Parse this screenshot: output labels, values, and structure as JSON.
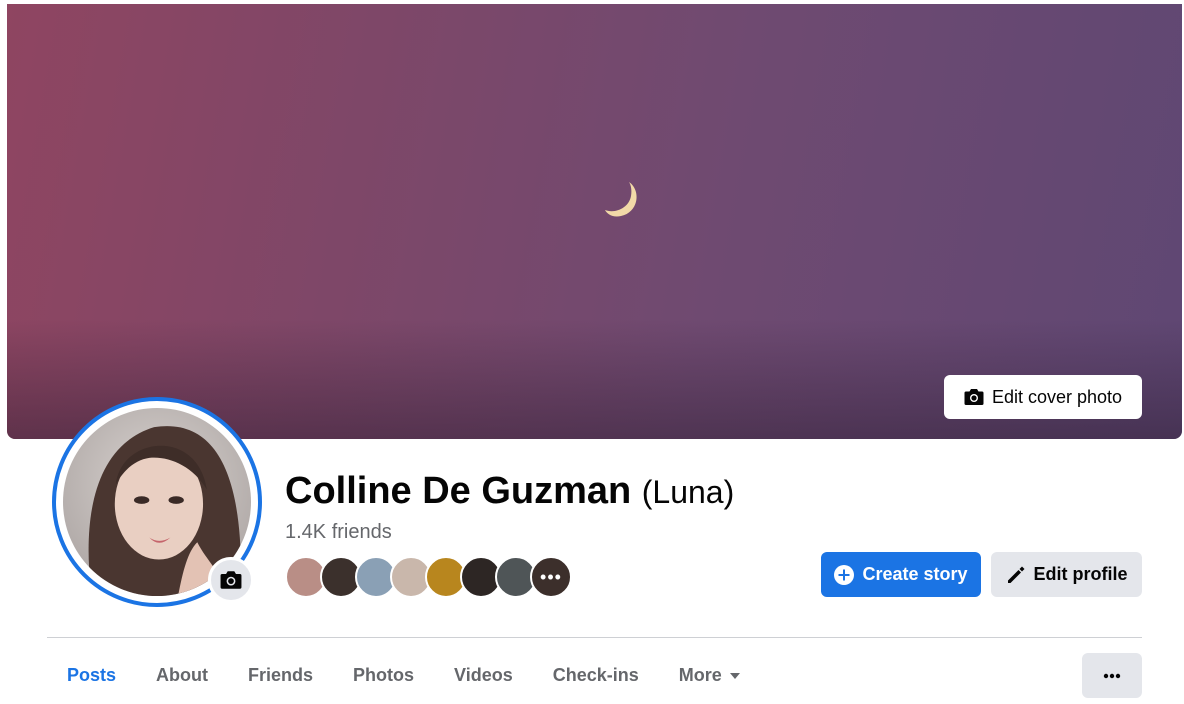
{
  "cover": {
    "edit_label": "Edit cover photo",
    "icon": "camera-icon"
  },
  "profile": {
    "name": "Colline De Guzman",
    "nickname": "(Luna)",
    "friends_count": "1.4K friends",
    "avatar_camera_icon": "camera-icon"
  },
  "friend_avatars": [
    {
      "color": "#b98e86"
    },
    {
      "color": "#3b302c"
    },
    {
      "color": "#8aa0b5"
    },
    {
      "color": "#c9b7ab"
    },
    {
      "color": "#b8861e"
    },
    {
      "color": "#2d2624"
    },
    {
      "color": "#4f5557"
    },
    {
      "color": "#3c2f2b",
      "more": "•••"
    }
  ],
  "actions": {
    "create_story": "Create story",
    "create_story_icon": "plus-circle-icon",
    "edit_profile": "Edit profile",
    "edit_profile_icon": "pencil-icon"
  },
  "tabs": [
    {
      "label": "Posts",
      "active": true
    },
    {
      "label": "About"
    },
    {
      "label": "Friends"
    },
    {
      "label": "Photos"
    },
    {
      "label": "Videos"
    },
    {
      "label": "Check-ins"
    },
    {
      "label": "More",
      "dropdown": true
    }
  ],
  "more_options_icon": "ellipsis-icon",
  "colors": {
    "accent": "#1b74e4",
    "secondary_button": "#e4e6eb",
    "muted_text": "#65676b"
  }
}
